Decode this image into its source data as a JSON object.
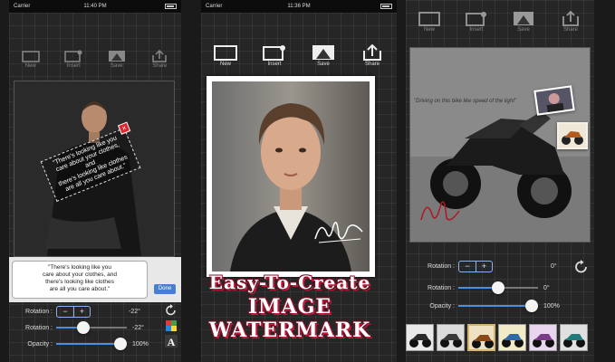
{
  "colors": {
    "accent": "#4a90e2",
    "banner_shadow": "#c0193a",
    "delete_badge": "#d9262b"
  },
  "phone1": {
    "status": {
      "carrier": "Carrier",
      "time": "11:40 PM"
    },
    "toolbar": [
      "New",
      "Insert",
      "Save",
      "Share"
    ],
    "watermark_text_lines": [
      "\"There's looking like you",
      "care about your clothes, and",
      "there's looking like clothes",
      "are all you care about.\""
    ],
    "text_input_value_lines": [
      "\"There's looking like you",
      "care about your clothes, and",
      "there's looking like clothes",
      "are all you care about.\""
    ],
    "done_label": "Done",
    "controls": {
      "rotation_stepper": {
        "label": "Rotation :",
        "minus": "−",
        "plus": "+",
        "value": "-22°"
      },
      "rotation_slider": {
        "label": "Rotation :",
        "value": "-22°",
        "level": 0.38
      },
      "opacity_slider": {
        "label": "Opacity :",
        "value": "100%",
        "level": 1.0
      }
    },
    "side_icons": [
      "rotate-reset-icon",
      "color-palette-icon",
      "font-icon"
    ]
  },
  "phone2": {
    "status": {
      "carrier": "Carrier",
      "time": "11:36 PM"
    },
    "toolbar": [
      "New",
      "Insert",
      "Save",
      "Share"
    ]
  },
  "phone3": {
    "toolbar": [
      "New",
      "Insert",
      "Save",
      "Share"
    ],
    "caption": "\"Driving on this bike like speed of the light\"",
    "controls": {
      "rotation_stepper": {
        "label": "Rotation :",
        "minus": "−",
        "plus": "+",
        "value": "0°"
      },
      "rotation_slider": {
        "label": "Rotation :",
        "value": "0°",
        "level": 0.5
      },
      "opacity_slider": {
        "label": "Opacity :",
        "value": "100%",
        "level": 1.0
      }
    },
    "thumbnail_count": 6,
    "selected_thumbnail": 2
  },
  "banner": {
    "line1": "Easy-To-Create",
    "line2": "IMAGE WATERMARK"
  }
}
